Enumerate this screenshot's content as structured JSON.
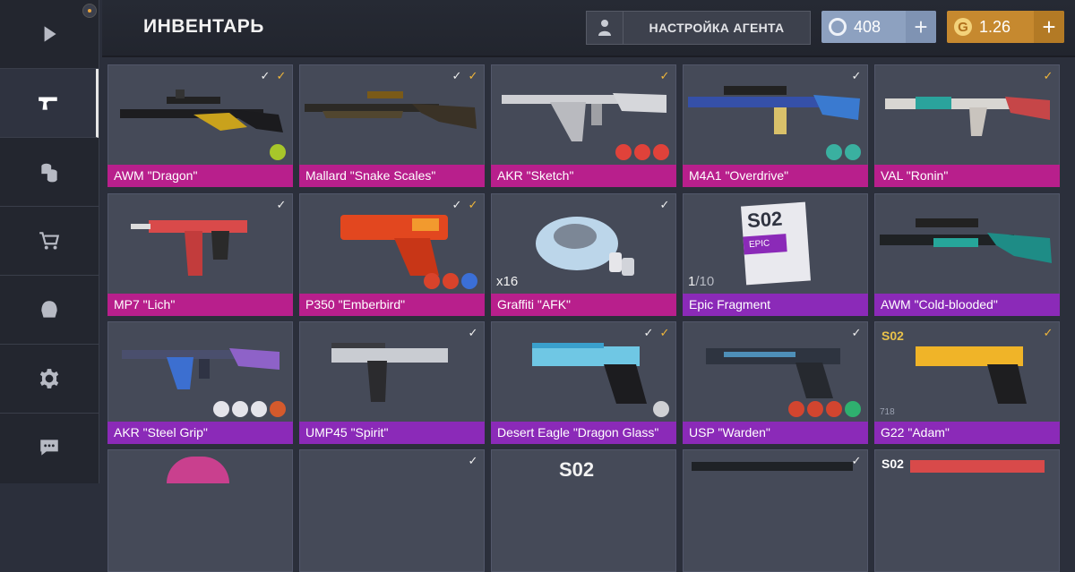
{
  "header": {
    "title": "ИНВЕНТАРЬ",
    "agent_button": "НАСТРОЙКА АГЕНТА",
    "silver_amount": "408",
    "gold_amount": "1.26",
    "plus_label": "+",
    "silver_coin": "C",
    "gold_coin": "G"
  },
  "sidebar": {
    "items": [
      {
        "icon": "play-icon"
      },
      {
        "icon": "pistol-icon",
        "active": true
      },
      {
        "icon": "coins-icon"
      },
      {
        "icon": "cart-icon"
      },
      {
        "icon": "agent-helmet-icon"
      },
      {
        "icon": "gear-icon"
      },
      {
        "icon": "chat-icon"
      }
    ]
  },
  "colors": {
    "rarity_pink": "#b81f8c",
    "rarity_purple": "#8b2ab8",
    "gold_currency": "#c6892f",
    "silver_currency": "#8da1c0"
  },
  "inventory": [
    {
      "name": "AWM \"Dragon\"",
      "rarity": "pink"
    },
    {
      "name": "Mallard \"Snake Scales\"",
      "rarity": "pink"
    },
    {
      "name": "AKR \"Sketch\"",
      "rarity": "pink"
    },
    {
      "name": "M4A1 \"Overdrive\"",
      "rarity": "pink"
    },
    {
      "name": "VAL \"Ronin\"",
      "rarity": "pink"
    },
    {
      "name": "MP7 \"Lich\"",
      "rarity": "pink"
    },
    {
      "name": "P350 \"Emberbird\"",
      "rarity": "pink"
    },
    {
      "name": "Graffiti \"AFK\"",
      "rarity": "pink",
      "quantity": "x16"
    },
    {
      "name": "Epic Fragment",
      "rarity": "purple",
      "fragment_have": "1",
      "fragment_sep": "/",
      "fragment_need": "10",
      "card_label": "S02",
      "card_sublabel": "EPIC"
    },
    {
      "name": "AWM \"Cold-blooded\"",
      "rarity": "purple"
    },
    {
      "name": "AKR \"Steel Grip\"",
      "rarity": "purple"
    },
    {
      "name": "UMP45 \"Spirit\"",
      "rarity": "purple"
    },
    {
      "name": "Desert Eagle \"Dragon Glass\"",
      "rarity": "purple"
    },
    {
      "name": "USP \"Warden\"",
      "rarity": "purple"
    },
    {
      "name": "G22 \"Adam\"",
      "rarity": "purple",
      "season_logo": "S02",
      "sticker_count": "718"
    }
  ],
  "bottom_row_logos": [
    "S02",
    "S02"
  ]
}
